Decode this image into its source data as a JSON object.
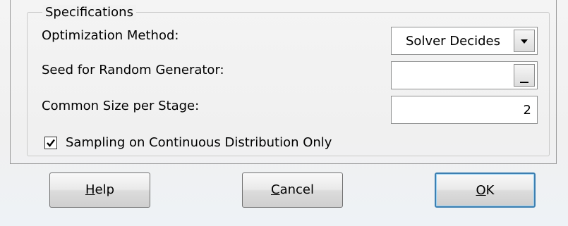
{
  "group": {
    "legend": "Specifications"
  },
  "fields": {
    "optimization_method": {
      "label": "Optimization Method:",
      "value": "Solver Decides"
    },
    "seed": {
      "label": "Seed for Random Generator:",
      "value": ""
    },
    "common_size": {
      "label": "Common Size per Stage:",
      "value": "2"
    }
  },
  "checkbox": {
    "label": "Sampling on Continuous Distribution Only",
    "checked": true
  },
  "buttons": {
    "help": {
      "mnemonic": "H",
      "rest": "elp"
    },
    "cancel": {
      "mnemonic": "C",
      "rest": "ancel"
    },
    "ok": {
      "mnemonic": "O",
      "rest": "K"
    }
  },
  "icons": {
    "dropdown": "chevron-down-icon",
    "checkmark": "checkmark-icon",
    "ellipsis": "ellipsis-button"
  }
}
